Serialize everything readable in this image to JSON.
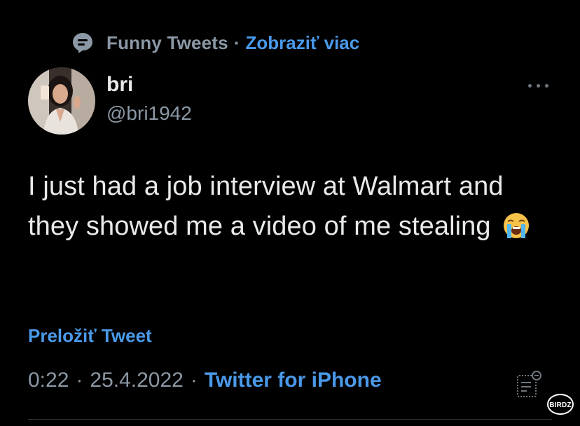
{
  "context": {
    "community": "Funny Tweets",
    "separator": "·",
    "show_more": "Zobraziť viac"
  },
  "author": {
    "name": "bri",
    "handle": "@bri1942"
  },
  "tweet": {
    "text": "I just had a job interview at Walmart and they showed me a video of me stealing",
    "emoji": "loudly-crying-face"
  },
  "translate_label": "Preložiť Tweet",
  "meta": {
    "time": "0:22",
    "date": "25.4.2022",
    "separator": "·",
    "source": "Twitter for iPhone"
  },
  "watermark": "BIRDZ",
  "colors": {
    "background": "#000000",
    "text": "#e7e9ea",
    "secondary": "#8b98a5",
    "link": "#4a99e9"
  }
}
